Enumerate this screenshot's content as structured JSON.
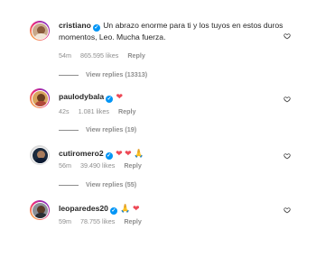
{
  "comments": [
    {
      "username": "cristiano",
      "text": "Un abrazo enorme para ti y los tuyos en estos duros momentos, Leo. Mucha fuerza.",
      "time": "54m",
      "likes": "865.595 likes",
      "reply_label": "Reply",
      "view_replies": "View replies (13313)"
    },
    {
      "username": "paulodybala",
      "text": "",
      "emoji": "❤",
      "time": "42s",
      "likes": "1.081 likes",
      "reply_label": "Reply",
      "view_replies": "View replies (19)"
    },
    {
      "username": "cutiromero2",
      "text": "",
      "emoji": "❤ ❤ 🙏",
      "time": "56m",
      "likes": "39.490 likes",
      "reply_label": "Reply",
      "view_replies": "View replies (55)"
    },
    {
      "username": "leoparedes20",
      "text": "",
      "emoji": "🙏 ❤",
      "time": "59m",
      "likes": "78.755 likes",
      "reply_label": "Reply"
    }
  ],
  "icons": {
    "verified": "verified-badge-icon",
    "like": "heart-outline-icon"
  },
  "colors": {
    "verified": "#0095f6",
    "heart": "#ed4956",
    "meta": "#8e8e8e"
  }
}
